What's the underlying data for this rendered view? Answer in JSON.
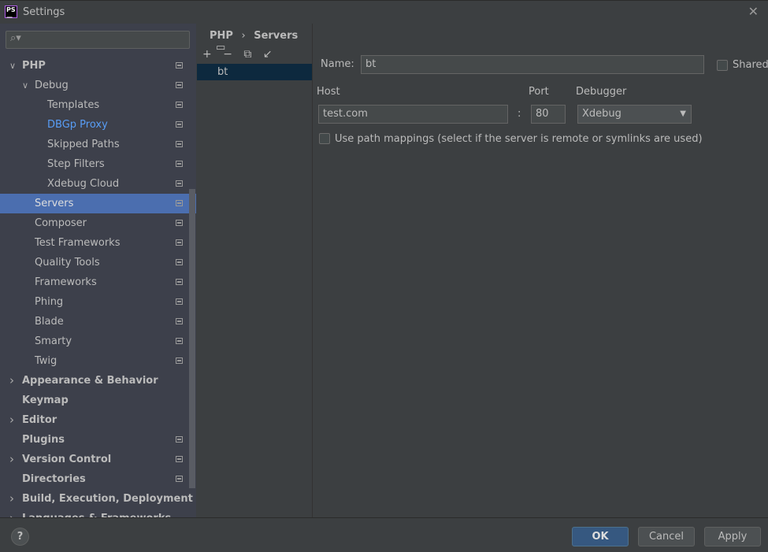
{
  "window": {
    "title": "Settings",
    "logo": "PS"
  },
  "search": {
    "placeholder": ""
  },
  "tree": [
    {
      "label": "PHP",
      "level": 0,
      "arrow": "down",
      "bold": true,
      "page_icon": true
    },
    {
      "label": "Debug",
      "level": 1,
      "arrow": "down",
      "page_icon": true
    },
    {
      "label": "Templates",
      "level": 2,
      "page_icon": true
    },
    {
      "label": "DBGp Proxy",
      "level": 2,
      "page_icon": true,
      "link": true
    },
    {
      "label": "Skipped Paths",
      "level": 2,
      "page_icon": true
    },
    {
      "label": "Step Filters",
      "level": 2,
      "page_icon": true
    },
    {
      "label": "Xdebug Cloud",
      "level": 2,
      "page_icon": true
    },
    {
      "label": "Servers",
      "level": 1,
      "page_icon": true,
      "selected": true
    },
    {
      "label": "Composer",
      "level": 1,
      "page_icon": true
    },
    {
      "label": "Test Frameworks",
      "level": 1,
      "page_icon": true
    },
    {
      "label": "Quality Tools",
      "level": 1,
      "page_icon": true
    },
    {
      "label": "Frameworks",
      "level": 1,
      "page_icon": true
    },
    {
      "label": "Phing",
      "level": 1,
      "page_icon": true
    },
    {
      "label": "Blade",
      "level": 1,
      "page_icon": true
    },
    {
      "label": "Smarty",
      "level": 1,
      "page_icon": true
    },
    {
      "label": "Twig",
      "level": 1,
      "page_icon": true
    },
    {
      "label": "Appearance & Behavior",
      "level": 0,
      "arrow": "right",
      "bold": true
    },
    {
      "label": "Keymap",
      "level": 0,
      "bold": true
    },
    {
      "label": "Editor",
      "level": 0,
      "arrow": "right",
      "bold": true
    },
    {
      "label": "Plugins",
      "level": 0,
      "bold": true,
      "page_icon": true
    },
    {
      "label": "Version Control",
      "level": 0,
      "arrow": "right",
      "bold": true,
      "page_icon": true
    },
    {
      "label": "Directories",
      "level": 0,
      "bold": true,
      "page_icon": true
    },
    {
      "label": "Build, Execution, Deployment",
      "level": 0,
      "arrow": "right",
      "bold": true
    },
    {
      "label": "Languages & Frameworks",
      "level": 0,
      "arrow": "right",
      "bold": true
    }
  ],
  "breadcrumb": {
    "parent": "PHP",
    "separator": "›",
    "current": "Servers"
  },
  "toolbar": {
    "add": "+",
    "remove": "−",
    "copy": "⧉",
    "import": "↙"
  },
  "servers": [
    "bt"
  ],
  "form": {
    "name_label": "Name:",
    "name_value": "bt",
    "shared_label": "Shared",
    "host_label": "Host",
    "host_value": "test.com",
    "colon": ":",
    "port_label": "Port",
    "port_value": "80",
    "debugger_label": "Debugger",
    "debugger_value": "Xdebug",
    "mappings_label": "Use path mappings (select if the server is remote or symlinks are used)"
  },
  "footer": {
    "help": "?",
    "ok": "OK",
    "cancel": "Cancel",
    "apply": "Apply"
  },
  "colors": {
    "selection": "#4b6eaf",
    "link": "#589df6",
    "ok": "#365880"
  }
}
